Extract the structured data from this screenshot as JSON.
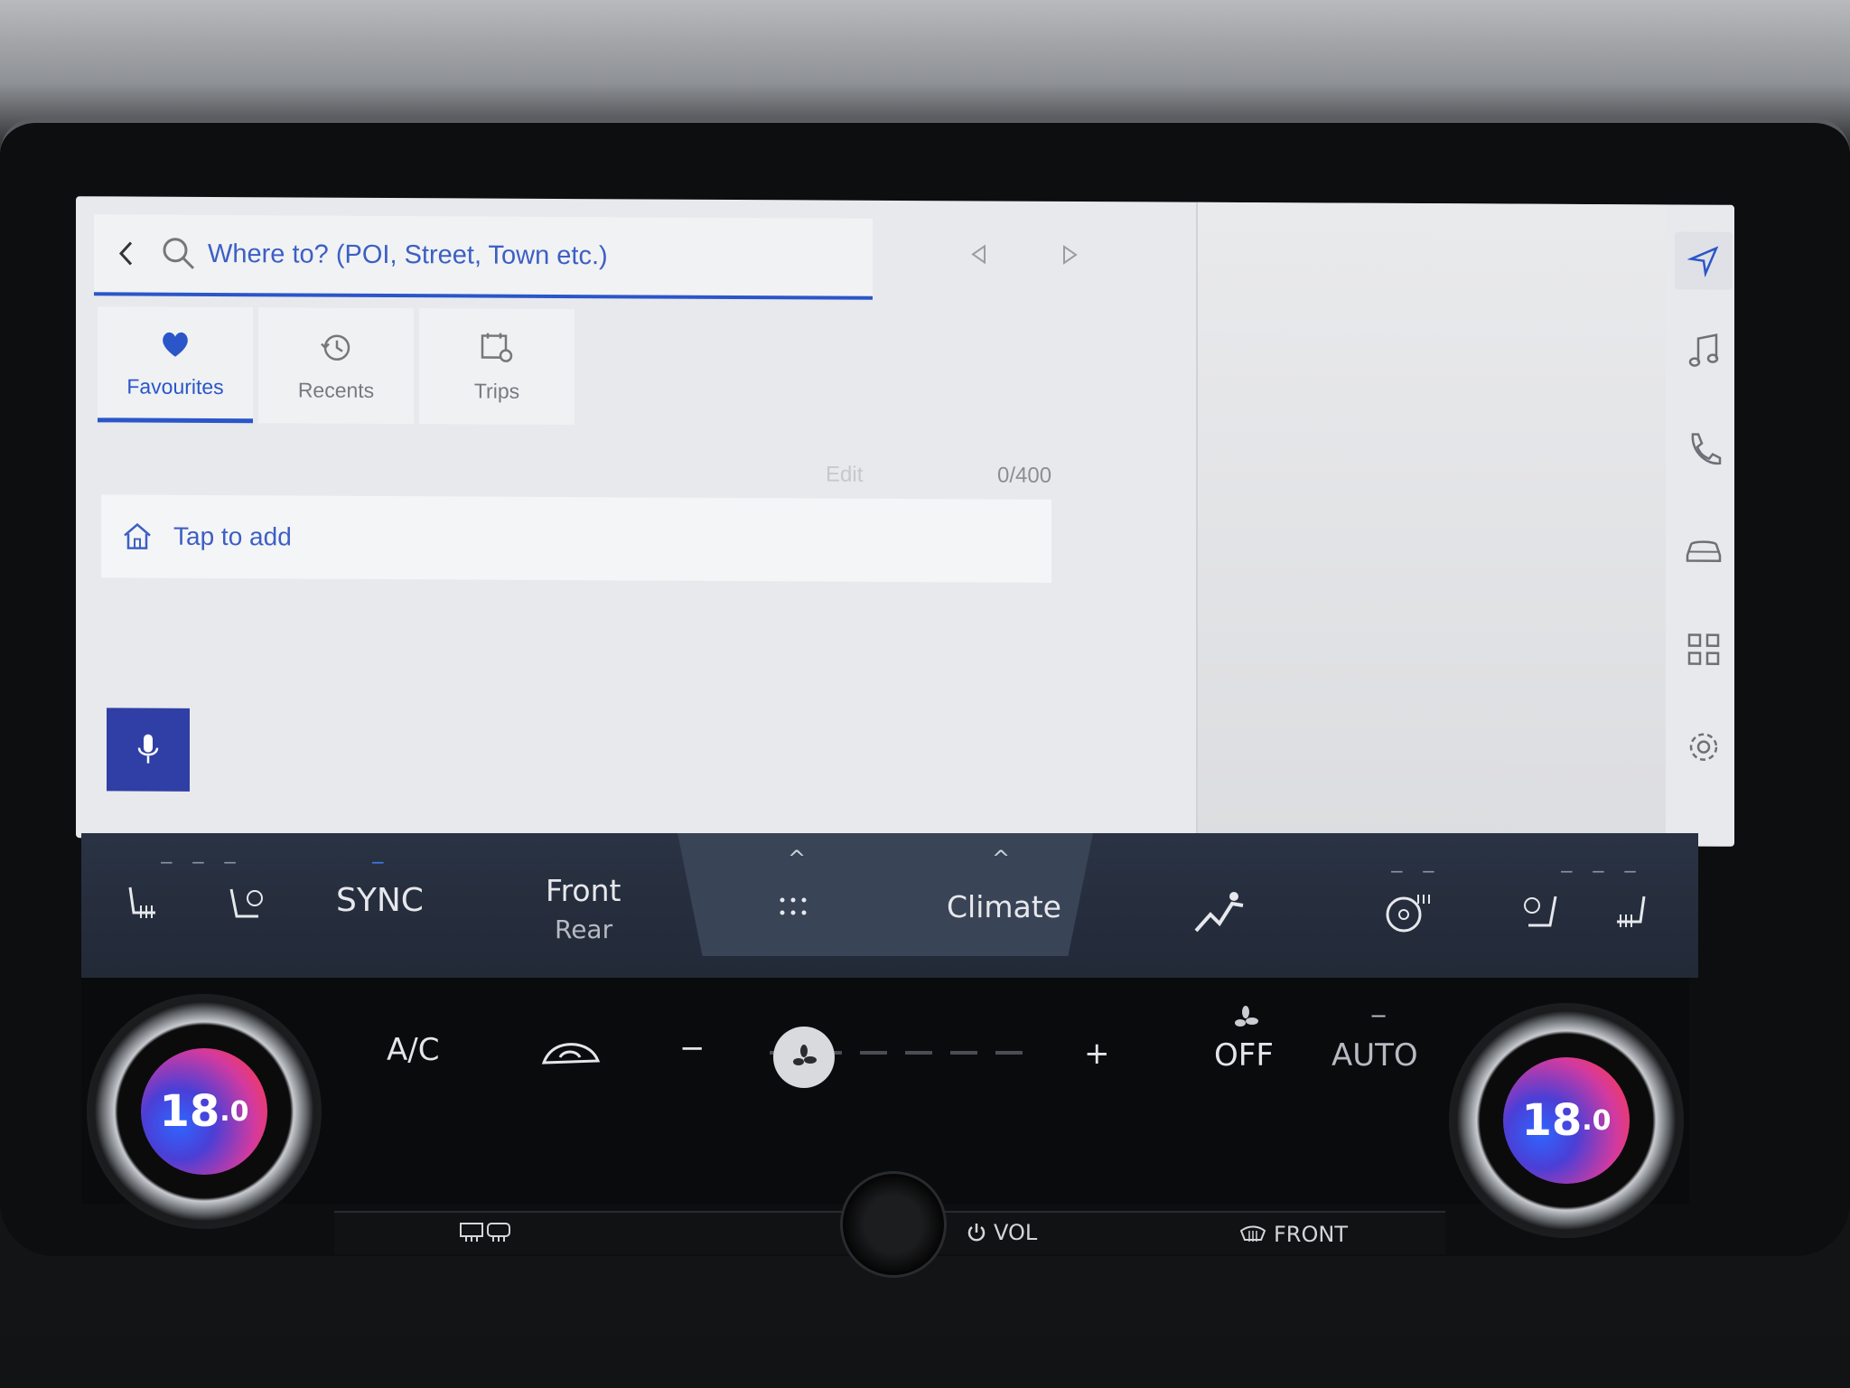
{
  "search": {
    "back_icon": "chevron-left-icon",
    "search_icon": "search-icon",
    "placeholder": "Where to? (POI, Street, Town etc.)"
  },
  "tabs": [
    {
      "label": "Favourites",
      "icon": "heart-icon",
      "active": true
    },
    {
      "label": "Recents",
      "icon": "history-icon",
      "active": false
    },
    {
      "label": "Trips",
      "icon": "calendar-pin-icon",
      "active": false
    }
  ],
  "list": {
    "edit_label": "Edit",
    "count": "0/400",
    "home_label": "Tap to add"
  },
  "side_menu": [
    "navigation-icon",
    "music-icon",
    "phone-icon",
    "car-icon",
    "apps-icon",
    "settings-icon"
  ],
  "climate": {
    "sync_label": "SYNC",
    "front_label": "Front",
    "rear_label": "Rear",
    "menu_icon": "grid-dots-icon",
    "climate_label": "Climate"
  },
  "hvac": {
    "ac_label": "A/C",
    "off_label": "OFF",
    "auto_label": "AUTO",
    "minus": "−",
    "plus": "+",
    "left_temp": "18",
    "left_temp_decimal": ".0",
    "right_temp": "18",
    "right_temp_decimal": ".0",
    "fan_level": 0
  },
  "bottom": {
    "vol_label": "VOL",
    "front_label": "FRONT"
  },
  "colors": {
    "accent": "#2a56c9",
    "mic_button": "#2f3fa6",
    "climate_bg": "#2a3344"
  }
}
